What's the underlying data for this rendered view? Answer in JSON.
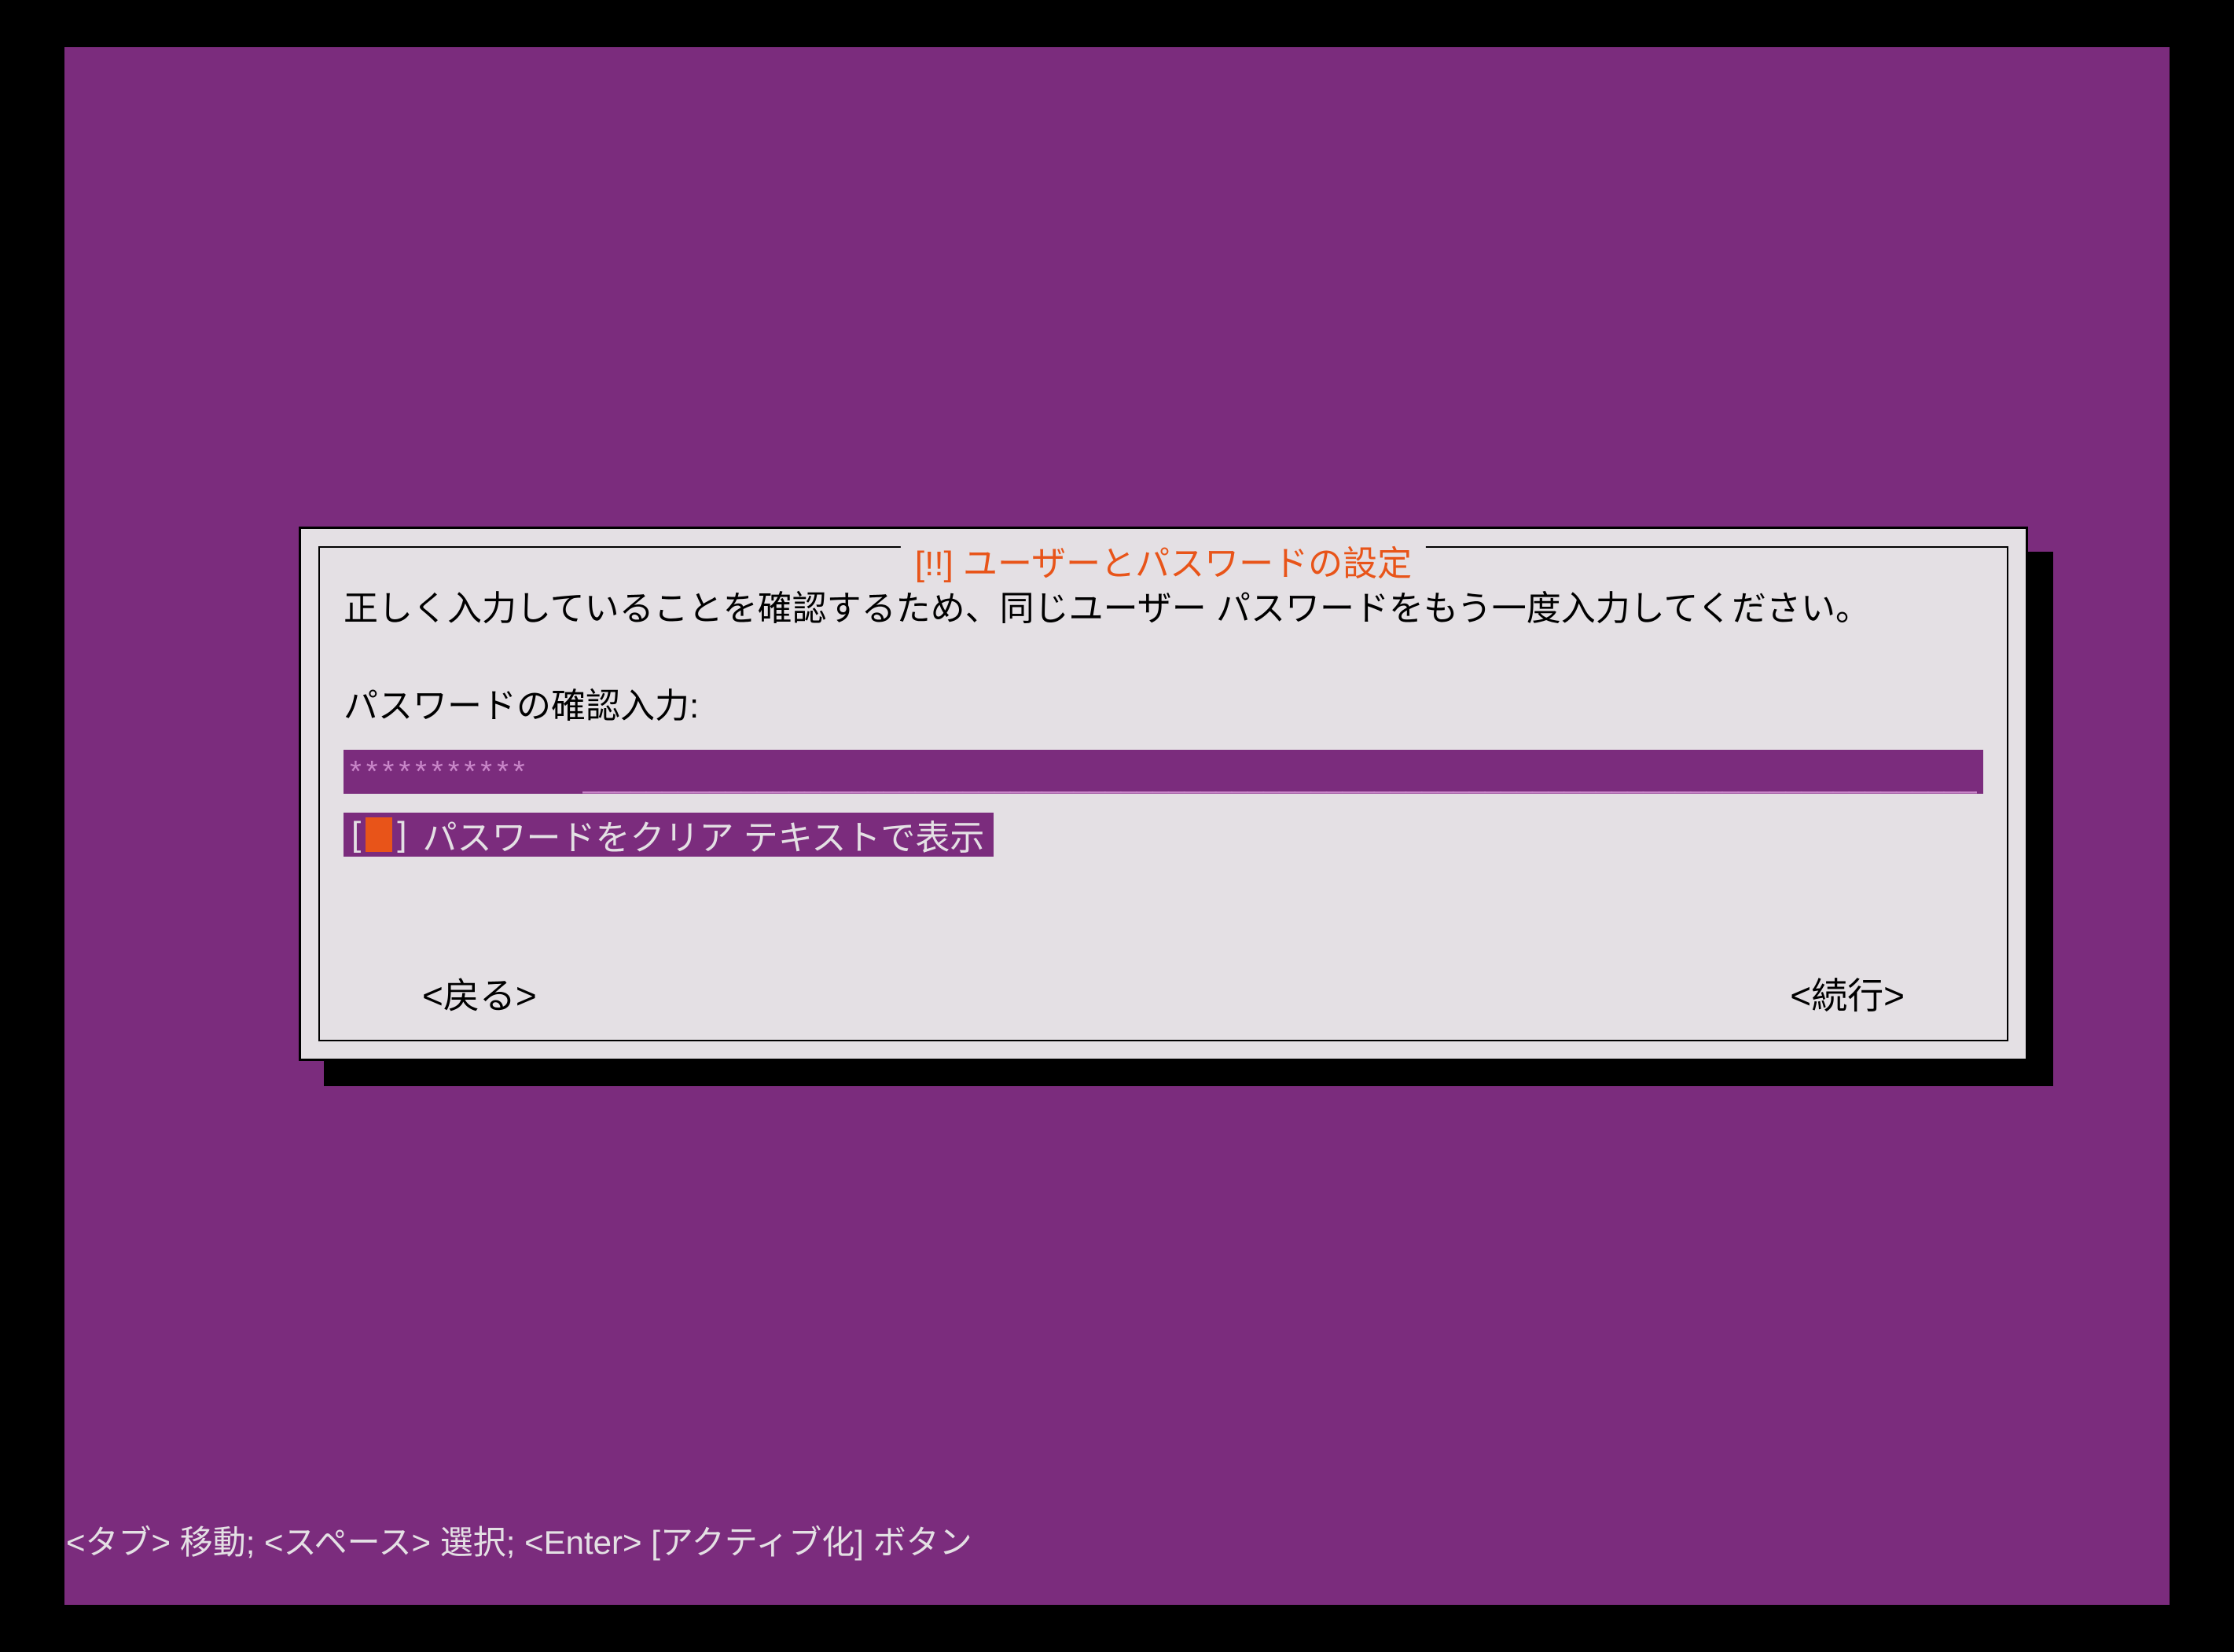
{
  "dialog": {
    "title": "[!!] ユーザーとパスワードの設定",
    "instruction": "正しく入力していることを確認するため、同じユーザー パスワードをもう一度入力してください。",
    "field_label": "パスワードの確認入力:",
    "password_mask": "***********",
    "password_line": "_________________________________________________________________________________________",
    "checkbox": {
      "open": "[",
      "close": "]",
      "label": "パスワードをクリア テキストで表示",
      "checked": false
    },
    "back_button": "<戻る>",
    "continue_button": "<続行>"
  },
  "footer": {
    "help": "<タブ> 移動; <スペース> 選択; <Enter> [アクティブ化] ボタン"
  },
  "colors": {
    "background": "#7b2c7d",
    "panel": "#e4e0e4",
    "accent": "#e85419"
  }
}
